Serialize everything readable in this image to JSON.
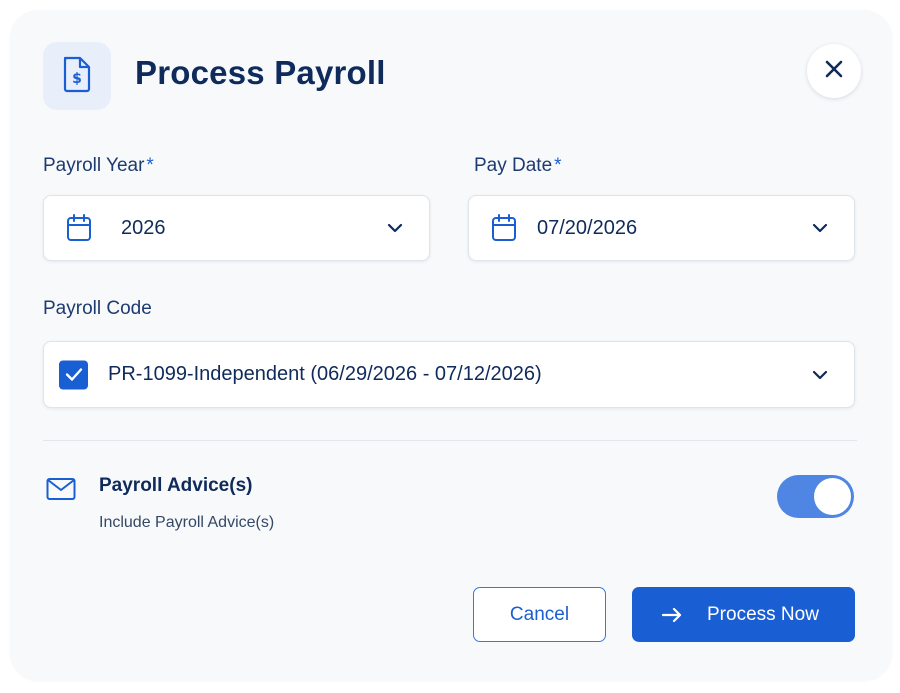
{
  "dialog": {
    "title": "Process Payroll",
    "header_icon": "dollar-document-icon",
    "close_icon": "close-icon"
  },
  "fields": {
    "payroll_year": {
      "label": "Payroll Year",
      "required_mark": "*",
      "value": "2026",
      "icon": "calendar-icon"
    },
    "pay_date": {
      "label": "Pay Date",
      "required_mark": "*",
      "value": "07/20/2026",
      "icon": "calendar-icon"
    },
    "payroll_code": {
      "label": "Payroll Code",
      "value": "PR-1099-Independent (06/29/2026 - 07/12/2026)",
      "checked": true
    }
  },
  "advice": {
    "icon": "mail-icon",
    "title": "Payroll Advice(s)",
    "subtitle": "Include Payroll Advice(s)",
    "toggle_on": true
  },
  "actions": {
    "cancel_label": "Cancel",
    "process_label": "Process Now",
    "process_icon": "arrow-right-icon"
  },
  "colors": {
    "primary": "#1a5ed3",
    "toggle": "#4f86e3",
    "title_text": "#0f2b5b",
    "panel_bg": "#f8f9fb"
  }
}
